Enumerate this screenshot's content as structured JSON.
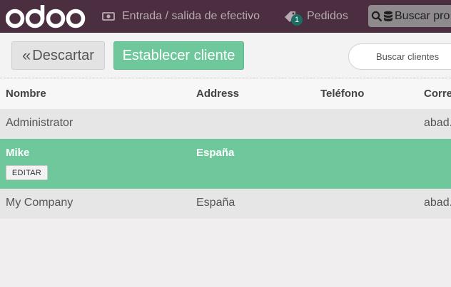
{
  "header": {
    "brand": "odoo",
    "cash_in_out_label": "Entrada / salida de efectivo",
    "orders_label": "Pedidos",
    "orders_badge": "1",
    "product_search_placeholder": "Buscar pro"
  },
  "controls": {
    "discard_label": "Descartar",
    "set_customer_label": "Establecer cliente",
    "customer_search_placeholder": "Buscar clientes"
  },
  "table": {
    "headers": {
      "name": "Nombre",
      "address": "Address",
      "phone": "Teléfono",
      "email": "Corre"
    },
    "rows": [
      {
        "name": "Administrator",
        "address": "",
        "phone": "",
        "email": "abad."
      },
      {
        "name": "Mike",
        "address": "España",
        "phone": "",
        "email": "",
        "edit_label": "EDITAR"
      },
      {
        "name": "My Company",
        "address": "España",
        "phone": "",
        "email": "abad."
      }
    ]
  },
  "colors": {
    "topbar": "#4b2e40",
    "accent_green": "#6ec89b",
    "badge": "#1a6e63"
  },
  "icons": {
    "cash": "money-icon",
    "orders": "tag-icon",
    "search": "search-icon",
    "database": "database-icon",
    "discard": "double-chevron-left-icon"
  }
}
